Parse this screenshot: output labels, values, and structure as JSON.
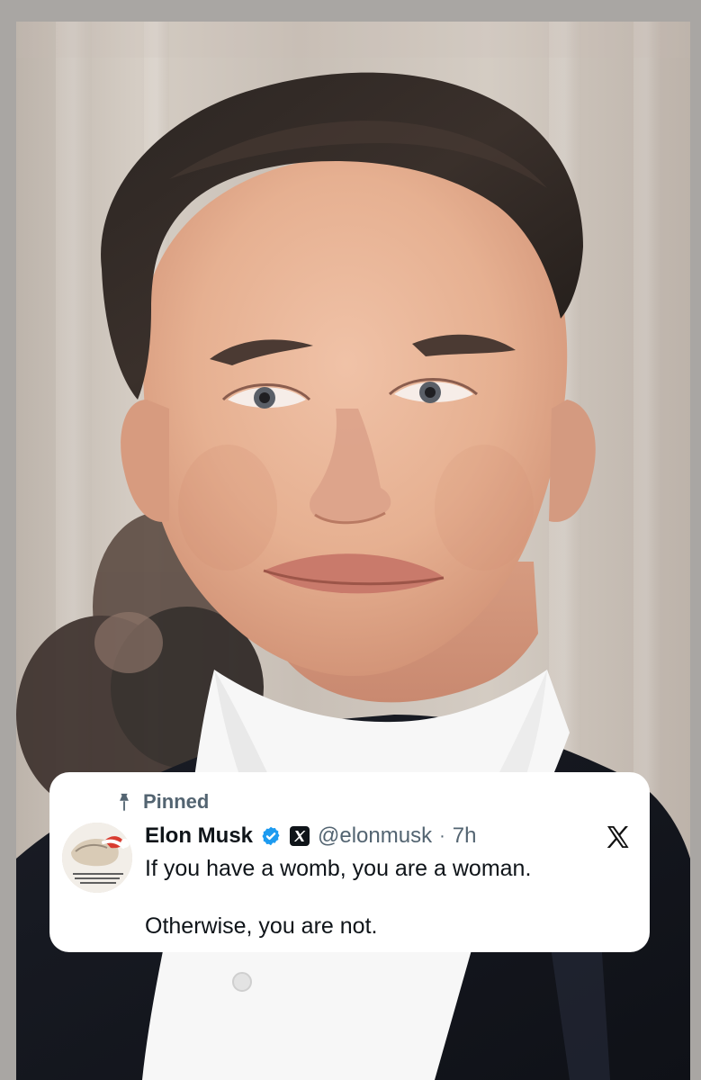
{
  "card": {
    "pinned_label": "Pinned",
    "display_name": "Elon Musk",
    "handle": "@elonmusk",
    "separator": "·",
    "time": "7h",
    "text_line_1": "If you have a womb, you are a woman.",
    "text_line_2": "Otherwise, you are not."
  },
  "icons": {
    "pin": "pin-icon",
    "verified": "verified-icon",
    "x_affiliate": "x-logo-icon",
    "x_brand": "x-logo-icon"
  },
  "colors": {
    "verified_blue": "#1d9bf0",
    "text_primary": "#0f1419",
    "text_secondary": "#536471",
    "card_bg": "#ffffff"
  }
}
